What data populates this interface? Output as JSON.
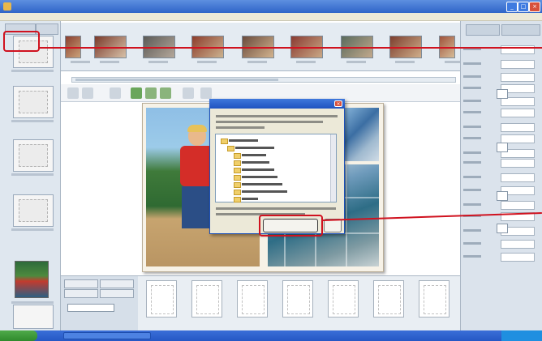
{
  "window": {
    "title": "",
    "controls": [
      "min-icon",
      "max-icon",
      "close-icon"
    ],
    "menu": []
  },
  "left_panel": {
    "tabs": [
      "",
      ""
    ],
    "pages": 6
  },
  "filmstrip": {
    "thumbnails": [
      {
        "colors": [
          "#8b3f2f",
          "#caa27a"
        ]
      },
      {
        "colors": [
          "#7a3a2b",
          "#d7c1a8"
        ]
      },
      {
        "colors": [
          "#5b5a57",
          "#b4a79a"
        ]
      },
      {
        "colors": [
          "#8d3d2c",
          "#cbb28f"
        ]
      },
      {
        "colors": [
          "#6a4b3d",
          "#d2b38e"
        ]
      },
      {
        "colors": [
          "#8a3b32",
          "#c9a885"
        ]
      },
      {
        "colors": [
          "#5a6b5d",
          "#c2a98c"
        ]
      },
      {
        "colors": [
          "#7d3f2f",
          "#cfae8a"
        ]
      },
      {
        "colors": [
          "#a0533b",
          "#d5bc98"
        ]
      }
    ]
  },
  "dialog": {
    "title": "",
    "ok_label": "",
    "close_icon": "×",
    "folders": [
      "",
      "",
      "",
      "",
      "",
      "",
      "",
      "",
      ""
    ]
  },
  "bottom_panel": {
    "buttons": [
      "",
      "",
      "",
      ""
    ],
    "input_value": "",
    "layouts": 7
  },
  "taskbar": {
    "start_label": "",
    "items": [
      ""
    ]
  },
  "colors": {
    "highlight": "#d0121f",
    "titlebar": "#2f64c8",
    "panel": "#dfe7ef"
  }
}
